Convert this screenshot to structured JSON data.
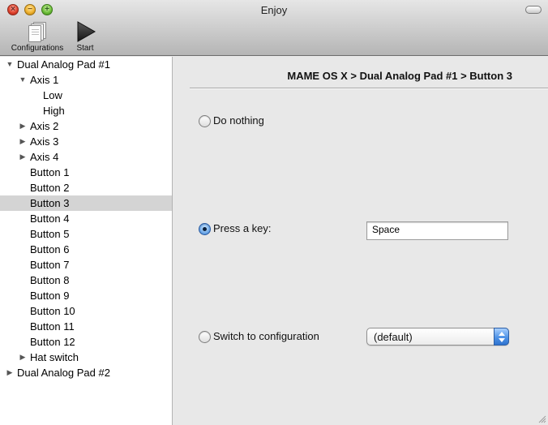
{
  "window": {
    "title": "Enjoy"
  },
  "toolbar": {
    "configurations_label": "Configurations",
    "configurations_icon": "documents-icon",
    "start_label": "Start",
    "start_icon": "play-icon"
  },
  "sidebar": {
    "items": [
      {
        "label": "Dual Analog Pad #1",
        "level": 0,
        "disclosure": "expanded",
        "selected": false
      },
      {
        "label": "Axis 1",
        "level": 1,
        "disclosure": "expanded",
        "selected": false
      },
      {
        "label": "Low",
        "level": 2,
        "disclosure": "none",
        "selected": false
      },
      {
        "label": "High",
        "level": 2,
        "disclosure": "none",
        "selected": false
      },
      {
        "label": "Axis 2",
        "level": 1,
        "disclosure": "collapsed",
        "selected": false
      },
      {
        "label": "Axis 3",
        "level": 1,
        "disclosure": "collapsed",
        "selected": false
      },
      {
        "label": "Axis 4",
        "level": 1,
        "disclosure": "collapsed",
        "selected": false
      },
      {
        "label": "Button 1",
        "level": 1,
        "disclosure": "none",
        "selected": false
      },
      {
        "label": "Button 2",
        "level": 1,
        "disclosure": "none",
        "selected": false
      },
      {
        "label": "Button 3",
        "level": 1,
        "disclosure": "none",
        "selected": true
      },
      {
        "label": "Button 4",
        "level": 1,
        "disclosure": "none",
        "selected": false
      },
      {
        "label": "Button 5",
        "level": 1,
        "disclosure": "none",
        "selected": false
      },
      {
        "label": "Button 6",
        "level": 1,
        "disclosure": "none",
        "selected": false
      },
      {
        "label": "Button 7",
        "level": 1,
        "disclosure": "none",
        "selected": false
      },
      {
        "label": "Button 8",
        "level": 1,
        "disclosure": "none",
        "selected": false
      },
      {
        "label": "Button 9",
        "level": 1,
        "disclosure": "none",
        "selected": false
      },
      {
        "label": "Button 10",
        "level": 1,
        "disclosure": "none",
        "selected": false
      },
      {
        "label": "Button 11",
        "level": 1,
        "disclosure": "none",
        "selected": false
      },
      {
        "label": "Button 12",
        "level": 1,
        "disclosure": "none",
        "selected": false
      },
      {
        "label": "Hat switch",
        "level": 1,
        "disclosure": "collapsed",
        "selected": false
      },
      {
        "label": "Dual Analog Pad #2",
        "level": 0,
        "disclosure": "collapsed",
        "selected": false
      }
    ]
  },
  "main": {
    "breadcrumb": "MAME OS X > Dual Analog Pad #1 > Button 3",
    "options": {
      "do_nothing": {
        "label": "Do nothing",
        "selected": false
      },
      "press_key": {
        "label": "Press a key:",
        "selected": true,
        "key_value": "Space"
      },
      "switch_config": {
        "label": "Switch to configuration",
        "selected": false,
        "selected_config": "(default)"
      }
    }
  },
  "colors": {
    "selection_gray": "#d4d4d4",
    "aqua_blue": "#4f93e6",
    "window_bg": "#e8e8e8"
  }
}
